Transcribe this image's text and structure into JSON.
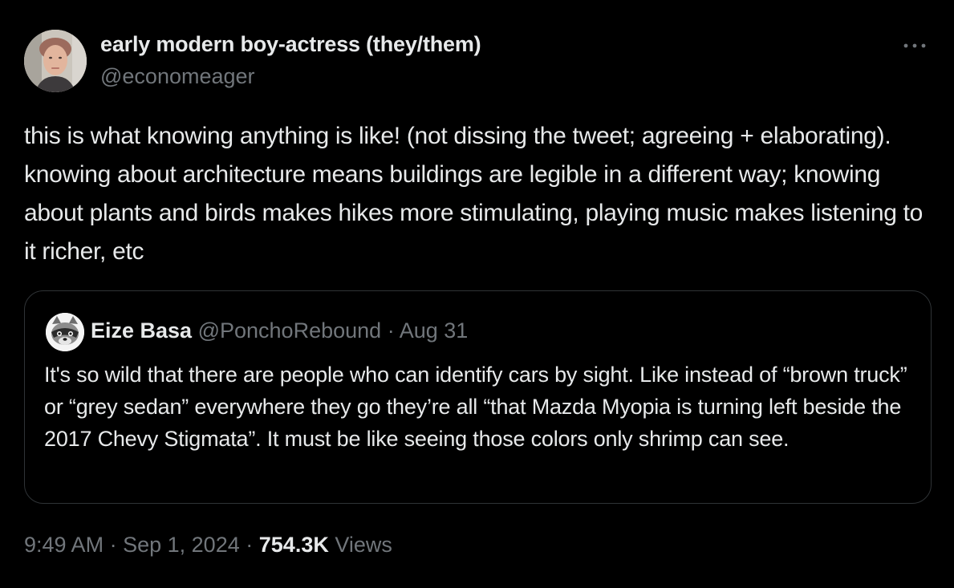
{
  "author": {
    "display_name": "early modern boy-actress (they/them)",
    "handle": "@economeager"
  },
  "tweet": {
    "text": "this is what knowing anything is like! (not dissing the tweet; agreeing + elaborating). knowing about architecture means buildings are legible in a different way; knowing about plants and birds makes hikes more stimulating, playing music makes listening to it richer, etc"
  },
  "quoted_tweet": {
    "display_name": "Eize Basa",
    "handle": "@PonchoRebound",
    "separator": "·",
    "date": "Aug 31",
    "text": "It's so wild that there are people who can identify cars by sight. Like instead of “brown truck” or “grey sedan” everywhere they go they’re all “that Mazda Myopia is turning left beside the 2017 Chevy Stigmata”. It must be like seeing those colors only shrimp can see."
  },
  "meta": {
    "time": "9:49 AM",
    "separator_1": "·",
    "date": "Sep 1, 2024",
    "separator_2": "·",
    "views_count": "754.3K",
    "views_label": "Views"
  },
  "icons": {
    "more": "more-horizontal-icon",
    "author_avatar": "avatar-photo",
    "quote_avatar": "raccoon-avatar"
  },
  "colors": {
    "background": "#000000",
    "primary_text": "#e7e9ea",
    "secondary_text": "#71767b",
    "border": "#2f3336"
  }
}
